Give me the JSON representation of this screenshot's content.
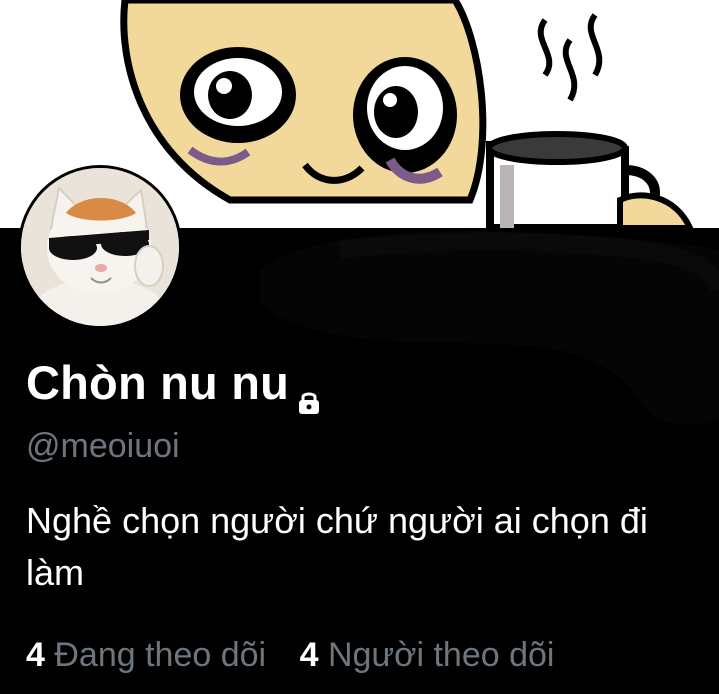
{
  "profile": {
    "display_name": "Chòn nu nu",
    "handle": "@meoiuoi",
    "bio": "Nghề chọn người chứ người ai chọn đi làm",
    "protected_icon": "lock-icon",
    "banner_icon": "cartoon-face-with-coffee",
    "avatar_icon": "cat-with-sunglasses"
  },
  "stats": {
    "following_count": "4",
    "following_label": "Đang theo dõi",
    "followers_count": "4",
    "followers_label": "Người theo dõi"
  },
  "colors": {
    "background": "#000000",
    "text_primary": "#ffffff",
    "text_secondary": "#6e767d"
  }
}
